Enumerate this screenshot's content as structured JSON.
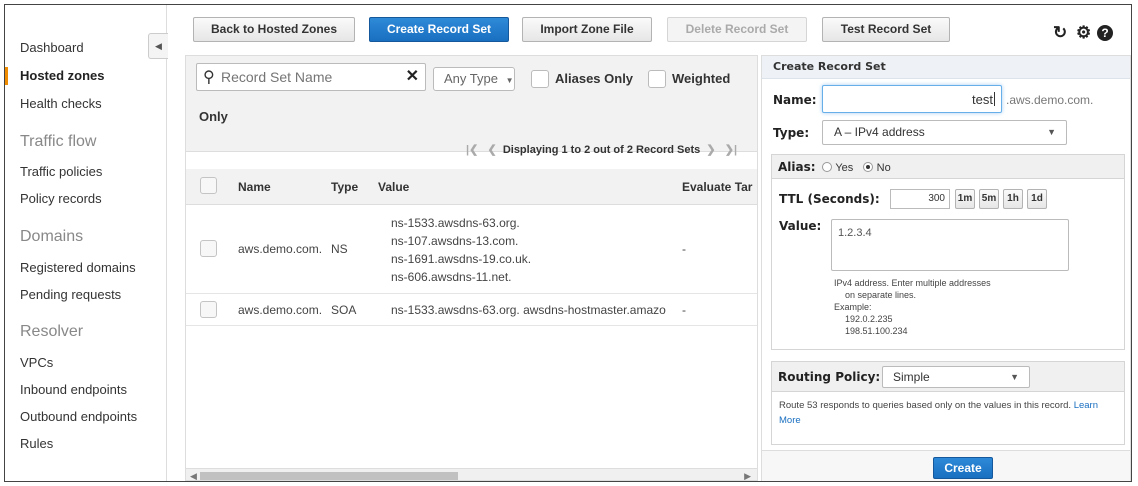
{
  "sidebar": {
    "items": [
      {
        "label": "Dashboard"
      },
      {
        "label": "Hosted zones"
      },
      {
        "label": "Health checks"
      },
      {
        "label": "Traffic policies"
      },
      {
        "label": "Policy records"
      },
      {
        "label": "Registered domains"
      },
      {
        "label": "Pending requests"
      },
      {
        "label": "VPCs"
      },
      {
        "label": "Inbound endpoints"
      },
      {
        "label": "Outbound endpoints"
      },
      {
        "label": "Rules"
      }
    ],
    "sections": {
      "traffic_flow": "Traffic flow",
      "domains": "Domains",
      "resolver": "Resolver"
    },
    "collapse_icon": "chevron-left-icon",
    "active_color": "#f08c00"
  },
  "toolbar": {
    "back_label": "Back to Hosted Zones",
    "create_label": "Create Record Set",
    "import_label": "Import Zone File",
    "delete_label": "Delete Record Set",
    "test_label": "Test Record Set",
    "icons": [
      "refresh-icon",
      "gear-icon",
      "help-icon"
    ],
    "primary_color": "#1a6fc0"
  },
  "filters": {
    "search_placeholder": "Record Set Name",
    "type_value": "Any Type",
    "aliases_only": "Aliases Only",
    "weighted": "Weighted",
    "only": "Only"
  },
  "pager": {
    "text": "Displaying 1 to 2 out of 2 Record Sets"
  },
  "table": {
    "columns": [
      "Name",
      "Type",
      "Value",
      "Evaluate Tar"
    ],
    "rows": [
      {
        "name": "aws.demo.com.",
        "type": "NS",
        "values": [
          "ns-1533.awsdns-63.org.",
          "ns-107.awsdns-13.com.",
          "ns-1691.awsdns-19.co.uk.",
          "ns-606.awsdns-11.net."
        ],
        "evaluate": "-"
      },
      {
        "name": "aws.demo.com.",
        "type": "SOA",
        "values": [
          "ns-1533.awsdns-63.org. awsdns-hostmaster.amazo"
        ],
        "evaluate": "-"
      }
    ]
  },
  "form": {
    "title": "Create Record Set",
    "name_label": "Name:",
    "name_value": "test",
    "name_suffix": ".aws.demo.com.",
    "type_label": "Type:",
    "type_value": "A – IPv4 address",
    "alias_label": "Alias:",
    "alias_yes": "Yes",
    "alias_no": "No",
    "alias_selected": "No",
    "ttl_label": "TTL (Seconds):",
    "ttl_value": "300",
    "ttl_buttons": [
      "1m",
      "5m",
      "1h",
      "1d"
    ],
    "value_label": "Value:",
    "value_text": "1.2.3.4",
    "hint_lines": [
      "IPv4 address. Enter multiple addresses",
      "on separate lines.",
      "Example:",
      "192.0.2.235",
      "198.51.100.234"
    ],
    "routing_label": "Routing Policy:",
    "routing_value": "Simple",
    "routing_desc": "Route 53 responds to queries based only on the values in this record.",
    "learn_more": "Learn More",
    "create_label": "Create"
  }
}
